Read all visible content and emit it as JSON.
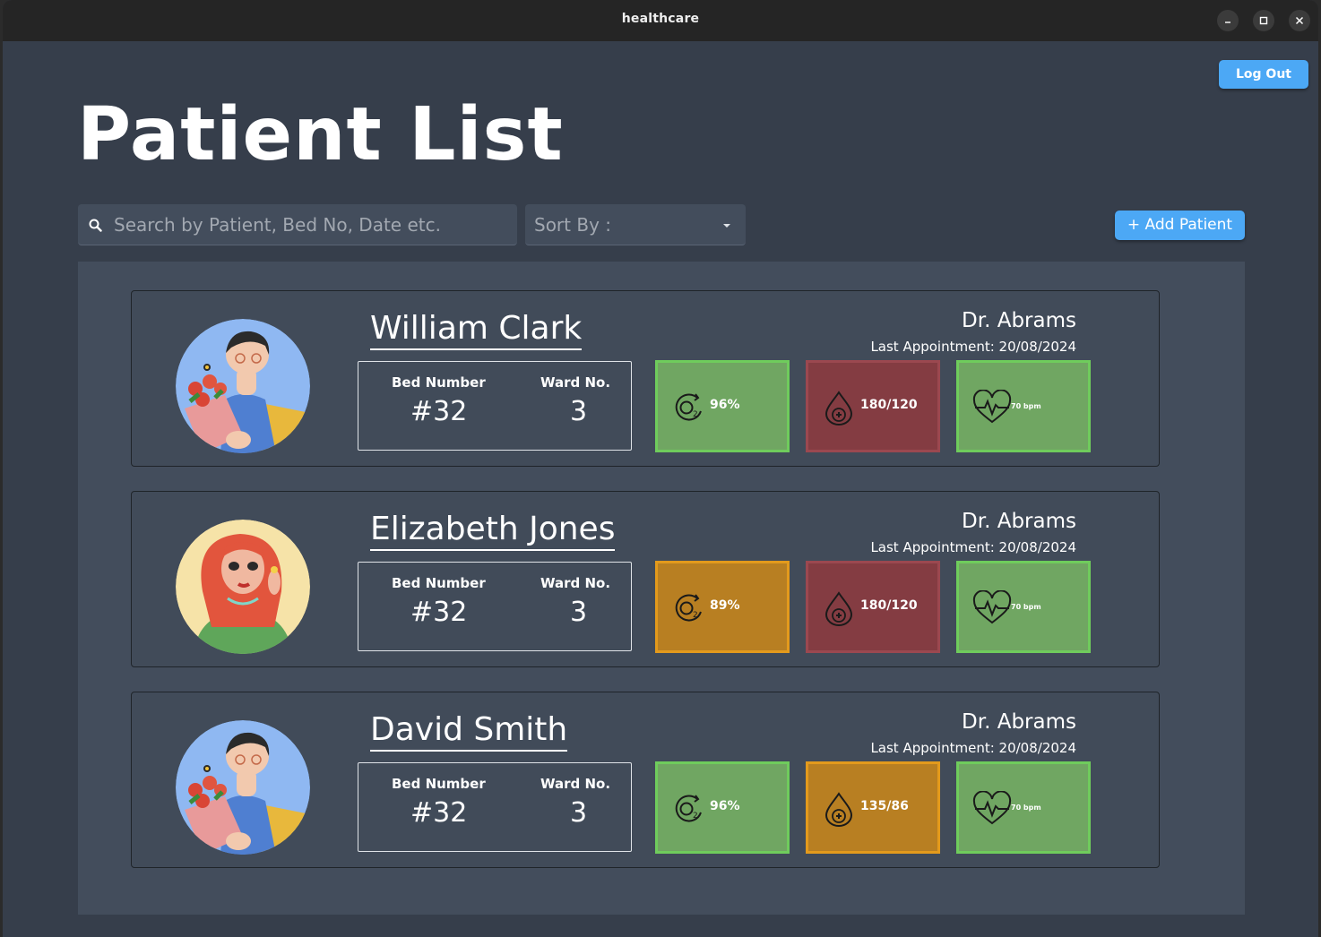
{
  "window": {
    "title": "healthcare"
  },
  "header": {
    "logout_label": "Log Out",
    "page_title": "Patient List",
    "search_placeholder": "Search by Patient, Bed No, Date etc.",
    "sort_label": "Sort By :",
    "add_patient_label": "+ Add Patient"
  },
  "labels": {
    "bed_number": "Bed Number",
    "ward_no": "Ward No."
  },
  "colors": {
    "good": "#70a662",
    "good_border": "#6fcc5c",
    "warn": "#b87f22",
    "warn_border": "#e39a1c",
    "bad": "#843c42",
    "bad_border": "#9b4850"
  },
  "patients": [
    {
      "name": "William Clark",
      "doctor": "Dr. Abrams",
      "last_appointment": "Last Appointment: 20/08/2024",
      "bed": "#32",
      "ward": "3",
      "avatar": "avatar-man-flowers",
      "oxygen": {
        "value": "96%",
        "status": "good"
      },
      "blood_pressure": {
        "value": "180/120",
        "status": "bad"
      },
      "heart_rate": {
        "value": "70 bpm",
        "status": "good"
      }
    },
    {
      "name": "Elizabeth Jones",
      "doctor": "Dr. Abrams",
      "last_appointment": "Last Appointment: 20/08/2024",
      "bed": "#32",
      "ward": "3",
      "avatar": "avatar-woman-red-hair",
      "oxygen": {
        "value": "89%",
        "status": "warn"
      },
      "blood_pressure": {
        "value": "180/120",
        "status": "bad"
      },
      "heart_rate": {
        "value": "70 bpm",
        "status": "good"
      }
    },
    {
      "name": "David Smith",
      "doctor": "Dr. Abrams",
      "last_appointment": "Last Appointment: 20/08/2024",
      "bed": "#32",
      "ward": "3",
      "avatar": "avatar-man-flowers",
      "oxygen": {
        "value": "96%",
        "status": "good"
      },
      "blood_pressure": {
        "value": "135/86",
        "status": "warn"
      },
      "heart_rate": {
        "value": "70 bpm",
        "status": "good"
      }
    }
  ]
}
